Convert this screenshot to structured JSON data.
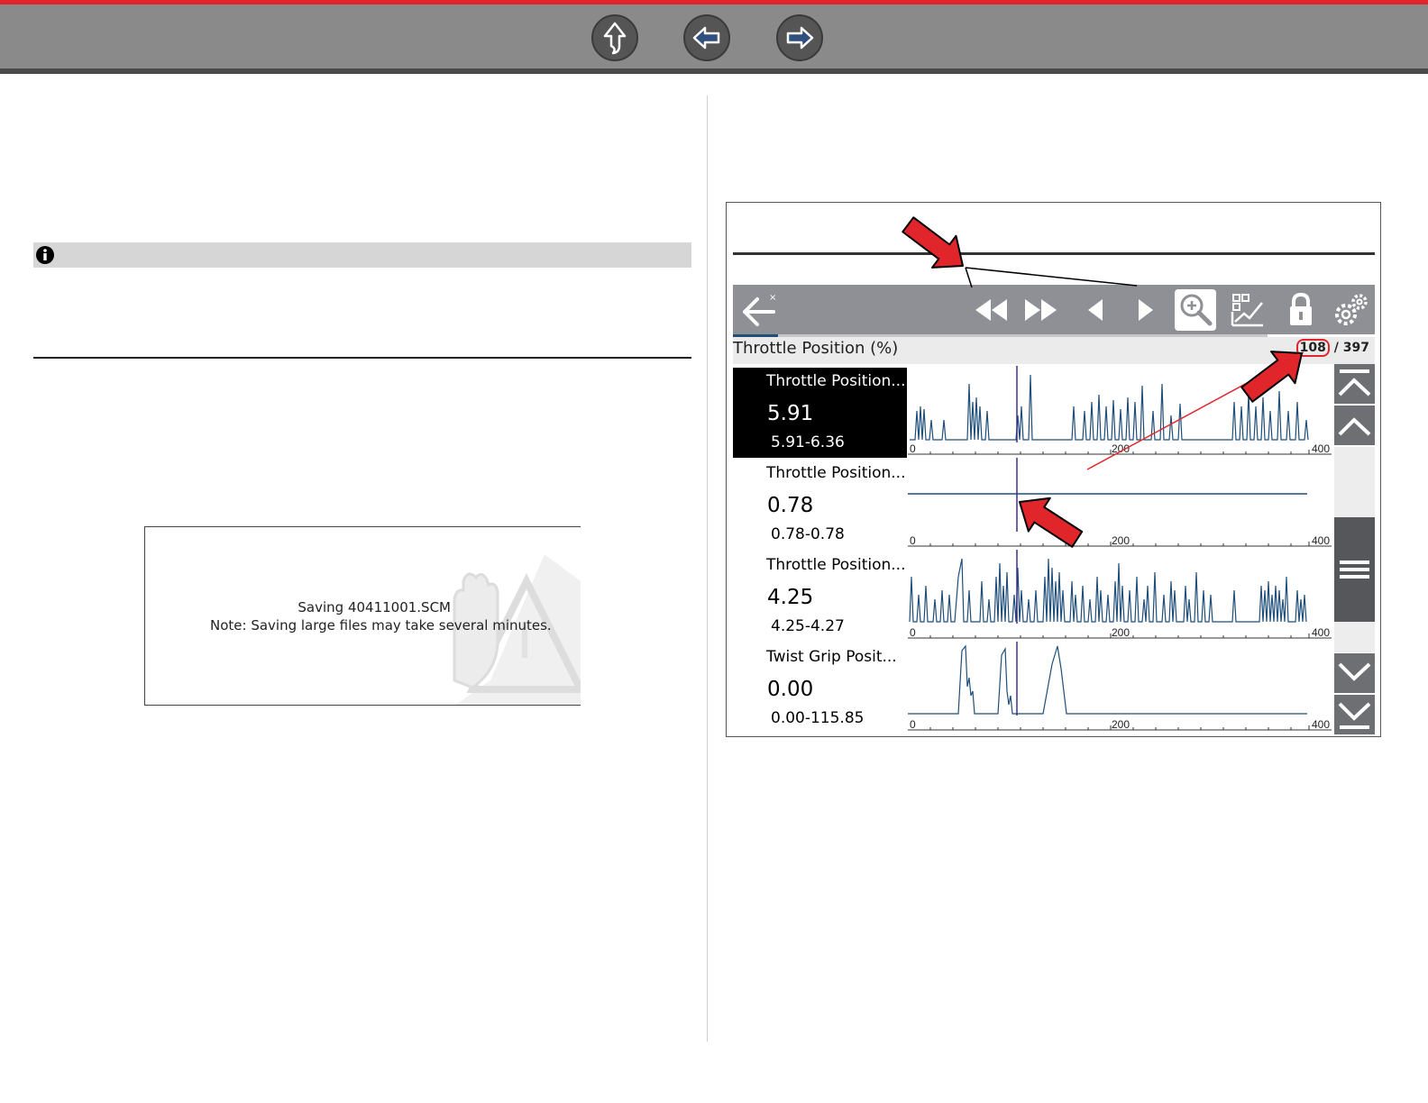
{
  "nav": {
    "buttons": [
      {
        "name": "home-up-button",
        "icon": "up-arrow-icon"
      },
      {
        "name": "previous-page-button",
        "icon": "left-arrow-icon"
      },
      {
        "name": "next-page-button",
        "icon": "right-arrow-icon"
      }
    ]
  },
  "colors": {
    "top_stripe": "#e0262b",
    "toolbar_gray": "#8a8a8a",
    "graph_line": "#1f4e79",
    "cursor_line": "#3a2f8f",
    "annotation_red": "#e0262b"
  },
  "note": {
    "icon": "info-icon"
  },
  "dialog": {
    "line1": "Saving 40411001.SCM",
    "line2": "Note: Saving large files may take several minutes.",
    "watermark": "stop-hand-warning-icon"
  },
  "scanner": {
    "toolbar": {
      "buttons": [
        "back-icon",
        "rewind-icon",
        "fast-forward-icon",
        "step-back-icon",
        "step-forward-icon",
        "zoom-icon",
        "graph-display-icon",
        "lock-icon",
        "settings-icon"
      ]
    },
    "pid_title": "Throttle Position (%)",
    "frame_current": "108",
    "frame_sep": " / ",
    "frame_total": "397",
    "params": [
      {
        "name": "Throttle Position...",
        "value": "5.91",
        "range": "5.91-6.36",
        "selected": true
      },
      {
        "name": "Throttle Position...",
        "value": "0.78",
        "range": "0.78-0.78",
        "selected": false
      },
      {
        "name": "Throttle Position...",
        "value": "4.25",
        "range": "4.25-4.27",
        "selected": false
      },
      {
        "name": "Twist Grip Posit...",
        "value": "0.00",
        "range": "0.00-115.85",
        "selected": false
      }
    ],
    "axis_labels": [
      "0",
      "200",
      "400"
    ],
    "scroll_buttons": [
      "scroll-top-icon",
      "scroll-up-icon",
      "scroll-handle-icon",
      "scroll-down-icon",
      "scroll-bottom-icon"
    ]
  }
}
